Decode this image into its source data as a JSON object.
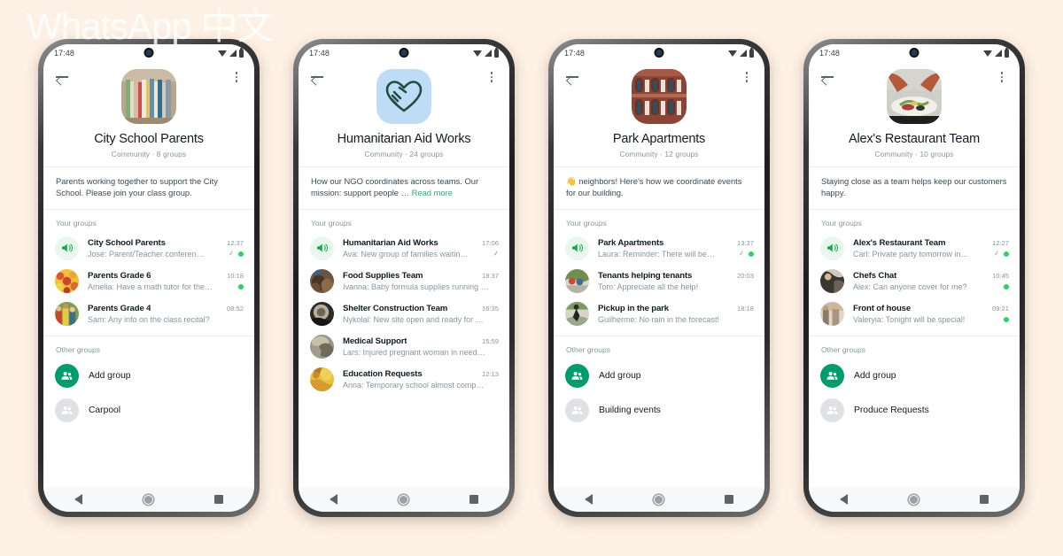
{
  "watermark": "WhatsApp 中文",
  "theme": {
    "background": "#fdf0e4",
    "accent_green": "#25d366",
    "brand_green": "#009c6b",
    "link_blue": "#53bdeb",
    "link_green": "#3aa27b",
    "text_primary": "#111b21",
    "text_secondary": "#8696a0"
  },
  "status_bar": {
    "time": "17:48",
    "icons": [
      "wifi-icon",
      "signal-icon",
      "battery-icon"
    ]
  },
  "appbar": {
    "back_icon": "back-arrow-icon",
    "menu_icon": "kebab-menu-icon"
  },
  "navbar": {
    "back": "nav-back-icon",
    "home": "nav-home-icon",
    "recents": "nav-recents-icon"
  },
  "labels": {
    "your_groups": "Your groups",
    "other_groups": "Other groups",
    "read_more": "Read more"
  },
  "phones": [
    {
      "id": "city-school-parents",
      "avatar_kind": "photo-books",
      "name": "City School Parents",
      "meta": "Community · 8 groups",
      "description": "Parents working together to support the City School. Please join your class group.",
      "description_truncated": false,
      "groups": [
        {
          "name": "City School Parents",
          "time": "12:37",
          "message": "José: Parent/Teacher conferen…",
          "avatar_kind": "announcement",
          "pinned": true,
          "unread": true
        },
        {
          "name": "Parents Grade 6",
          "time": "10:18",
          "message": "Amelia: Have a math tutor for the…",
          "avatar_kind": "photo-kids",
          "pinned": false,
          "unread": true
        },
        {
          "name": "Parents Grade 4",
          "time": "08:52",
          "message": "Sam: Any info on the class recital?",
          "avatar_kind": "photo-group",
          "pinned": false,
          "unread": false
        }
      ],
      "other_groups": [
        {
          "label": "Add group",
          "icon": "add-group-icon",
          "style": "green"
        },
        {
          "label": "Carpool",
          "icon": "group-icon",
          "style": "grey"
        }
      ]
    },
    {
      "id": "humanitarian-aid-works",
      "avatar_kind": "logo-heart-hand",
      "name": "Humanitarian Aid Works",
      "meta": "Community · 24 groups",
      "description": "How our NGO coordinates across teams. Our mission: support people …",
      "description_truncated": true,
      "groups": [
        {
          "name": "Humanitarian Aid Works",
          "time": "17:06",
          "message": "Ava: New group of families waitin…",
          "avatar_kind": "announcement",
          "pinned": true,
          "unread": false
        },
        {
          "name": "Food Supplies Team",
          "time": "18:37",
          "message": "Ivanna: Baby formula supplies running …",
          "avatar_kind": "photo-supplies",
          "pinned": false,
          "unread": false
        },
        {
          "name": "Shelter Construction Team",
          "time": "16:35",
          "message": "Nykolai: New site open and ready for …",
          "avatar_kind": "photo-shelter",
          "pinned": false,
          "unread": false
        },
        {
          "name": "Medical Support",
          "time": "15:59",
          "message": "Lars: Injured pregnant woman in need…",
          "avatar_kind": "photo-medical",
          "pinned": false,
          "unread": false
        },
        {
          "name": "Education Requests",
          "time": "12:13",
          "message": "Anna: Temporary school almost comp…",
          "avatar_kind": "photo-education",
          "pinned": false,
          "unread": false
        }
      ],
      "other_groups": []
    },
    {
      "id": "park-apartments",
      "avatar_kind": "photo-building",
      "name": "Park Apartments",
      "meta": "Community · 12 groups",
      "description": "👋 neighbors! Here's how we coordinate events for our building.",
      "description_truncated": false,
      "groups": [
        {
          "name": "Park Apartments",
          "time": "13:37",
          "message": "Laura: Reminder: There will be…",
          "avatar_kind": "announcement",
          "pinned": true,
          "unread": true
        },
        {
          "name": "Tenants helping tenants",
          "time": "20:03",
          "message": "Tom: Appreciate all the help!",
          "avatar_kind": "photo-tenants",
          "pinned": false,
          "unread": false
        },
        {
          "name": "Pickup in the park",
          "time": "18:18",
          "message": "Guilherme: No rain in the forecast!",
          "avatar_kind": "photo-park",
          "pinned": false,
          "unread": false
        }
      ],
      "other_groups": [
        {
          "label": "Add group",
          "icon": "add-group-icon",
          "style": "green"
        },
        {
          "label": "Building events",
          "icon": "group-icon",
          "style": "grey"
        }
      ]
    },
    {
      "id": "alexs-restaurant-team",
      "avatar_kind": "photo-food",
      "name": "Alex's Restaurant Team",
      "meta": "Community · 10 groups",
      "description": "Staying close as a team helps keep our customers happy.",
      "description_truncated": false,
      "groups": [
        {
          "name": "Alex's Restaurant Team",
          "time": "12:27",
          "message": "Carl: Private party tomorrow in…",
          "avatar_kind": "announcement",
          "pinned": true,
          "unread": true
        },
        {
          "name": "Chefs Chat",
          "time": "10:45",
          "message": "Alex: Can anyone cover for me?",
          "avatar_kind": "photo-chefs",
          "pinned": false,
          "unread": true
        },
        {
          "name": "Front of house",
          "time": "09:21",
          "message": "Valeryia: Tonight will be special!",
          "avatar_kind": "photo-front",
          "pinned": false,
          "unread": true
        }
      ],
      "other_groups": [
        {
          "label": "Add group",
          "icon": "add-group-icon",
          "style": "green"
        },
        {
          "label": "Produce Requests",
          "icon": "group-icon",
          "style": "grey"
        }
      ]
    }
  ]
}
